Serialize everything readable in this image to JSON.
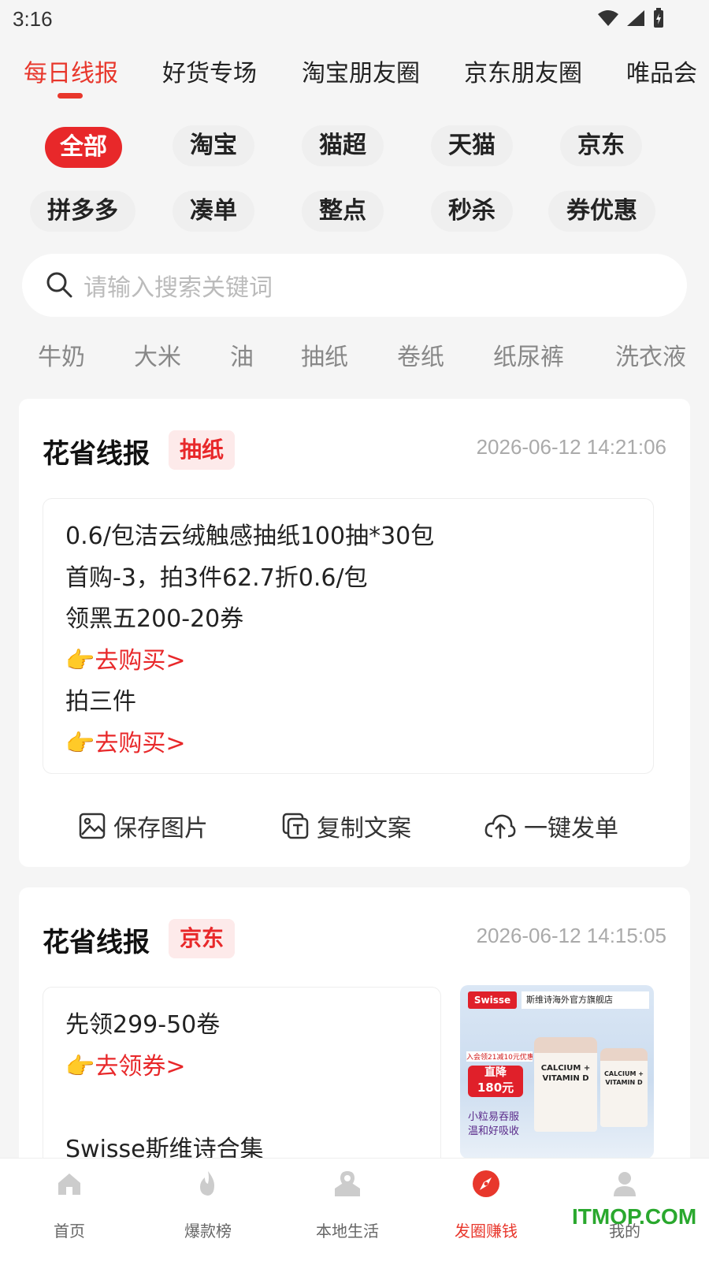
{
  "status_bar": {
    "time": "3:16"
  },
  "top_tabs": [
    "每日线报",
    "好货专场",
    "淘宝朋友圈",
    "京东朋友圈",
    "唯品会"
  ],
  "chips_row1": [
    "全部",
    "淘宝",
    "猫超",
    "天猫",
    "京东"
  ],
  "chips_row2": [
    "拼多多",
    "凑单",
    "整点",
    "秒杀",
    "券优惠"
  ],
  "search": {
    "placeholder": "请输入搜索关键词"
  },
  "keywords": [
    "牛奶",
    "大米",
    "油",
    "抽纸",
    "卷纸",
    "纸尿裤",
    "洗衣液"
  ],
  "cards": [
    {
      "title": "花省线报",
      "tag": "抽纸",
      "time": "2026-06-12 14:21:06",
      "lines": [
        {
          "finger": "",
          "text": "0.6/包洁云绒触感抽纸100抽*30包"
        },
        {
          "finger": "",
          "text": "首购-3，拍3件62.7折0.6/包"
        },
        {
          "finger": "",
          "text": "领黑五200-20券"
        },
        {
          "finger": "👉",
          "text": "去购买>"
        },
        {
          "finger": "",
          "text": "拍三件"
        },
        {
          "finger": "👉",
          "text": "去购买>"
        }
      ],
      "actions": [
        "保存图片",
        "复制文案",
        "一键发单"
      ]
    },
    {
      "title": "花省线报",
      "tag": "京东",
      "time": "2026-06-12 14:15:05",
      "lines": [
        {
          "finger": "",
          "text": "先领299-50卷"
        },
        {
          "finger": "👉",
          "text": "去领券>"
        },
        {
          "finger": "",
          "text": "Swisse斯维诗合集"
        }
      ],
      "image": {
        "brand": "Swisse",
        "store": "斯维诗海外官方旗舰店",
        "promo_top": "入会领21减10元优惠券",
        "promo_main": "直降",
        "promo_amount": "180元",
        "slogan1": "小粒易吞服",
        "slogan2": "温和好吸收",
        "product_name1": "CALCIUM +",
        "product_name2": "VITAMIN D"
      }
    }
  ],
  "bottom_nav": [
    "首页",
    "爆款榜",
    "本地生活",
    "发圈赚钱",
    "我的"
  ],
  "watermark": "ITMOP.COM",
  "colors": {
    "accent": "#e8372c",
    "tag_bg": "#fdeaea",
    "finger": "#f5b400"
  }
}
